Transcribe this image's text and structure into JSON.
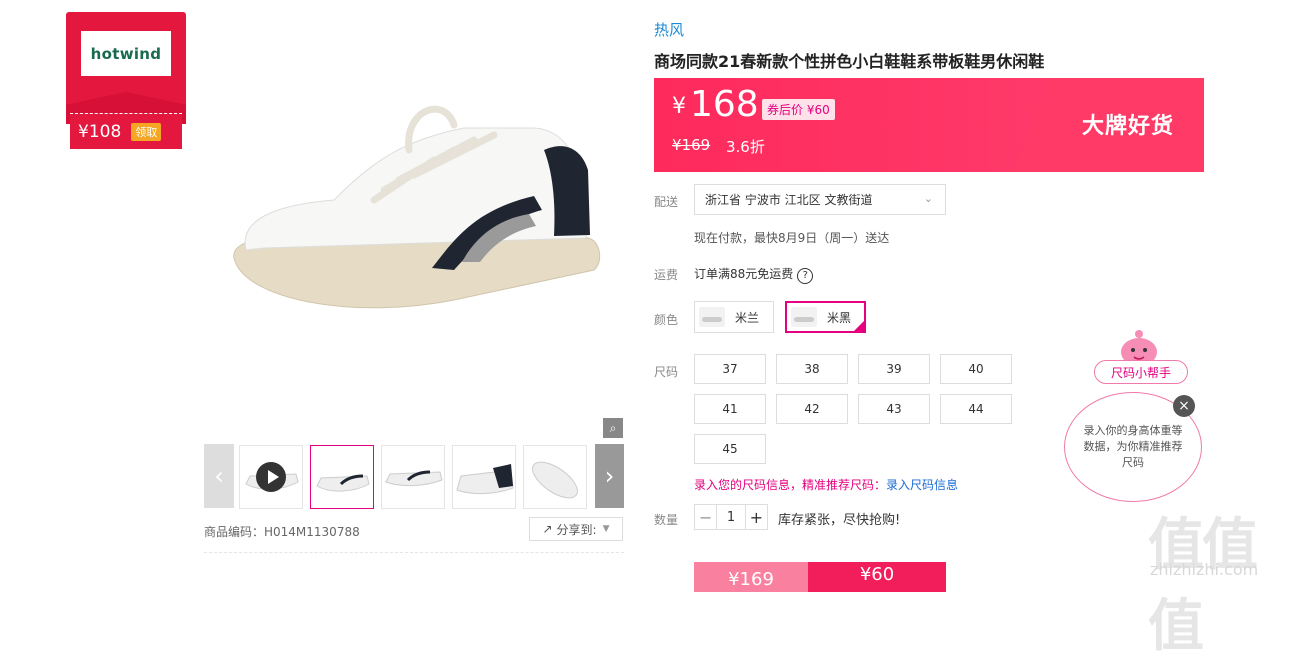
{
  "coupon": {
    "brand_logo": "hotwind",
    "price": "¥108",
    "action": "领取"
  },
  "product": {
    "brand": "热风",
    "title": "商场同款21春新款个性拼色小白鞋鞋系带板鞋男休闲鞋",
    "price_currency": "¥",
    "price_value": "168",
    "price_tag": "券后价 ¥60",
    "original_price": "¥169",
    "discount": "3.6折",
    "promo_banner": "大牌好货",
    "code_label": "商品编码：H014M1130788"
  },
  "delivery": {
    "label": "配送",
    "address": "浙江省 宁波市 江北区 文教街道",
    "eta": "现在付款，最快8月9日（周一）送达"
  },
  "shipping": {
    "label": "运费",
    "text": "订单满88元免运费",
    "help": "?"
  },
  "colors": {
    "label": "颜色",
    "options": [
      {
        "name": "米兰"
      },
      {
        "name": "米黑"
      }
    ]
  },
  "sizes": {
    "label": "尺码",
    "options": [
      "37",
      "38",
      "39",
      "40",
      "41",
      "42",
      "43",
      "44",
      "45"
    ],
    "info_prefix": "录入您的尺码信息，精准推荐尺码：",
    "info_link": "录入尺码信息"
  },
  "quantity": {
    "label": "数量",
    "minus": "−",
    "value": "1",
    "plus": "+",
    "stock": "库存紧张，尽快抢购!"
  },
  "buy": {
    "left_price": "¥169",
    "right_price": "¥60"
  },
  "gallery": {
    "share": "分享到:",
    "prev": "‹",
    "next": "›"
  },
  "helper": {
    "label": "尺码小帮手",
    "bubble": "录入你的身高体重等数据，为你精准推荐尺码",
    "close": "×"
  },
  "watermark": {
    "text": "值值值",
    "url": "zhizhizhi.com"
  }
}
